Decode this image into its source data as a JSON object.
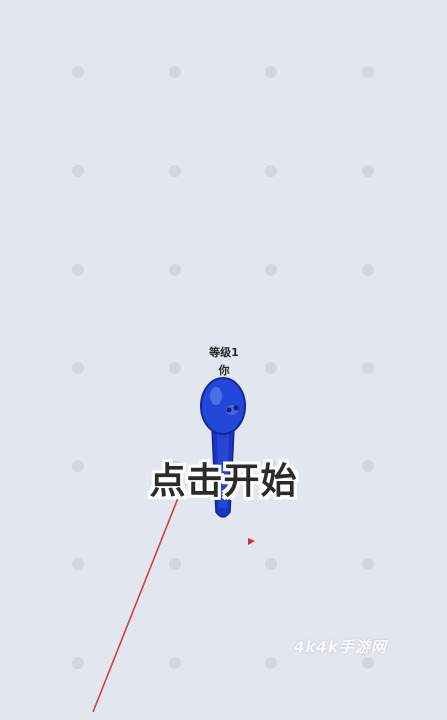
{
  "player": {
    "level_label": "等级1",
    "name_label": "你",
    "color": "#1f3fd0"
  },
  "prompt": {
    "start_text": "点击开始"
  },
  "watermark": {
    "text": "4k4k手游网"
  },
  "colors": {
    "background": "#e2e6ee",
    "grid_dot": "#d2d6de",
    "aim_line": "#e03a3a",
    "marker": "#d83030"
  },
  "icons": [
    "grid-dot",
    "player-character-icon",
    "aim-line",
    "target-marker-icon"
  ]
}
